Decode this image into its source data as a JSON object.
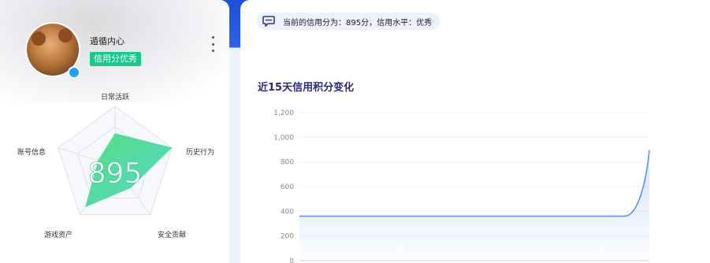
{
  "profile": {
    "username": "遁循内心",
    "level_badge": "信用分优秀"
  },
  "radar": {
    "score": "895",
    "axes": [
      "日常活跃",
      "历史行为",
      "安全贡献",
      "游戏资产",
      "账号信息"
    ],
    "values": [
      0.55,
      1.0,
      0.45,
      0.85,
      0.3
    ],
    "fill_colors": [
      "#4fdc7c",
      "#4ad6c6"
    ]
  },
  "summary_pill": {
    "text": "当前的信用分为：895分，信用水平：优秀",
    "icon": "chat-bubble-icon"
  },
  "chart_data": {
    "type": "area",
    "title": "近15天信用积分变化",
    "y_ticks": [
      "0",
      "200",
      "400",
      "600",
      "800",
      "1,000",
      "1,200"
    ],
    "ylim": [
      0,
      1200
    ],
    "values": [
      360,
      360,
      360,
      360,
      360,
      360,
      360,
      360,
      360,
      360,
      360,
      360,
      360,
      360,
      895
    ],
    "grid": true,
    "line_color": "#5b8ff0"
  }
}
